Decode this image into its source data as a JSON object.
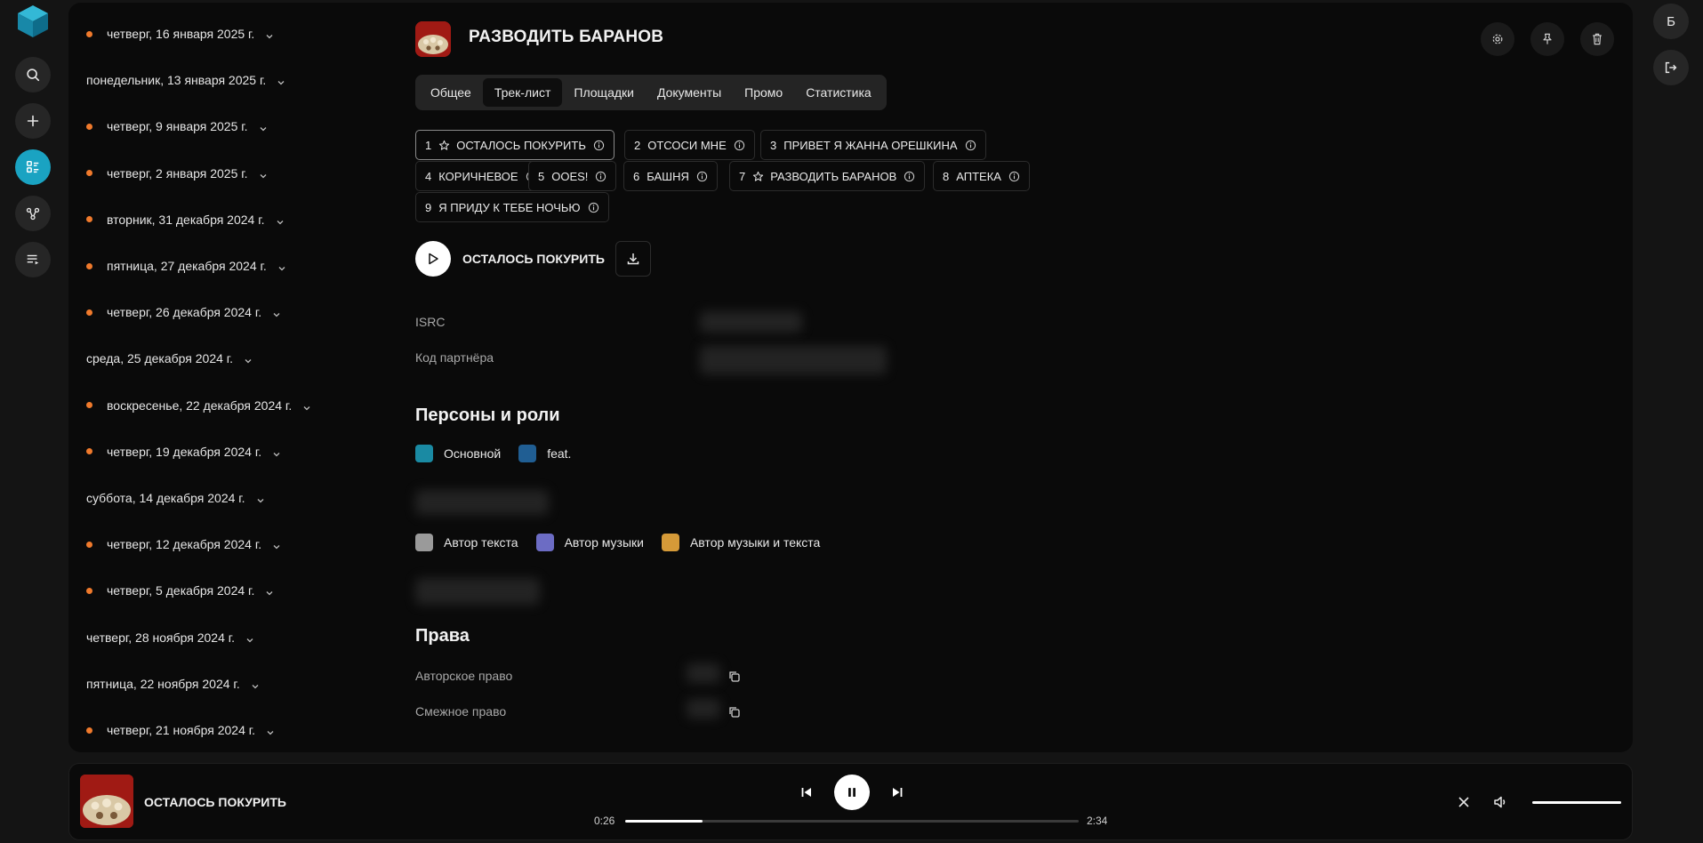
{
  "rail": {
    "items": [
      {
        "icon": "search-icon"
      },
      {
        "icon": "plus-icon"
      },
      {
        "icon": "releases-icon",
        "active": true
      },
      {
        "icon": "network-icon"
      },
      {
        "icon": "playlist-icon"
      }
    ]
  },
  "user": {
    "avatar_letter": "Б"
  },
  "dates": [
    {
      "label": "четверг, 16 января 2025 г.",
      "dot": true
    },
    {
      "label": "понедельник, 13 января 2025 г.",
      "dot": false
    },
    {
      "label": "четверг, 9 января 2025 г.",
      "dot": true
    },
    {
      "label": "четверг, 2 января 2025 г.",
      "dot": true
    },
    {
      "label": "вторник, 31 декабря 2024 г.",
      "dot": true
    },
    {
      "label": "пятница, 27 декабря 2024 г.",
      "dot": true
    },
    {
      "label": "четверг, 26 декабря 2024 г.",
      "dot": true
    },
    {
      "label": "среда, 25 декабря 2024 г.",
      "dot": false
    },
    {
      "label": "воскресенье, 22 декабря 2024 г.",
      "dot": true
    },
    {
      "label": "четверг, 19 декабря 2024 г.",
      "dot": true
    },
    {
      "label": "суббота, 14 декабря 2024 г.",
      "dot": false
    },
    {
      "label": "четверг, 12 декабря 2024 г.",
      "dot": true
    },
    {
      "label": "четверг, 5 декабря 2024 г.",
      "dot": true
    },
    {
      "label": "четверг, 28 ноября 2024 г.",
      "dot": false
    },
    {
      "label": "пятница, 22 ноября 2024 г.",
      "dot": false
    },
    {
      "label": "четверг, 21 ноября 2024 г.",
      "dot": true
    }
  ],
  "release": {
    "title": "РАЗВОДИТЬ БАРАНОВ"
  },
  "tabs": [
    {
      "label": "Общее"
    },
    {
      "label": "Трек-лист",
      "active": true
    },
    {
      "label": "Площадки"
    },
    {
      "label": "Документы"
    },
    {
      "label": "Промо"
    },
    {
      "label": "Статистика"
    }
  ],
  "tracks": [
    {
      "num": "1",
      "title": "ОСТАЛОСЬ ПОКУРИТЬ",
      "star": true,
      "active": true
    },
    {
      "num": "2",
      "title": "ОТСОСИ МНЕ",
      "star": false
    },
    {
      "num": "3",
      "title": "ПРИВЕТ Я ЖАННА ОРЕШКИНА",
      "star": false
    },
    {
      "num": "4",
      "title": "КОРИЧНЕВОЕ",
      "star": false
    },
    {
      "num": "5",
      "title": "OOES!",
      "star": false
    },
    {
      "num": "6",
      "title": "БАШНЯ",
      "star": false
    },
    {
      "num": "7",
      "title": "РАЗВОДИТЬ БАРАНОВ",
      "star": true
    },
    {
      "num": "8",
      "title": "АПТЕКА",
      "star": false
    },
    {
      "num": "9",
      "title": "Я ПРИДУ К ТЕБЕ НОЧЬЮ",
      "star": false
    }
  ],
  "selected_track": {
    "title": "ОСТАЛОСЬ ПОКУРИТЬ"
  },
  "fields": {
    "isrc_label": "ISRC",
    "partner_label": "Код партнёра"
  },
  "persons": {
    "heading": "Персоны и роли",
    "roles1": [
      {
        "label": "Основной",
        "color": "#1a8aa3"
      },
      {
        "label": "feat.",
        "color": "#205e93"
      }
    ],
    "roles2": [
      {
        "label": "Автор текста",
        "color": "#9a9a9a"
      },
      {
        "label": "Автор музыки",
        "color": "#6c6cc4"
      },
      {
        "label": "Автор музыки и текста",
        "color": "#d59a38"
      }
    ]
  },
  "rights": {
    "heading": "Права",
    "copyright_label": "Авторское право",
    "related_label": "Смежное право"
  },
  "player": {
    "title": "ОСТАЛОСЬ ПОКУРИТЬ",
    "current_time": "0:26",
    "duration": "2:34",
    "progress": 0.17,
    "volume": 1.0
  },
  "colors": {
    "accent": "#1aa3c2",
    "dot": "#f07a2c"
  }
}
